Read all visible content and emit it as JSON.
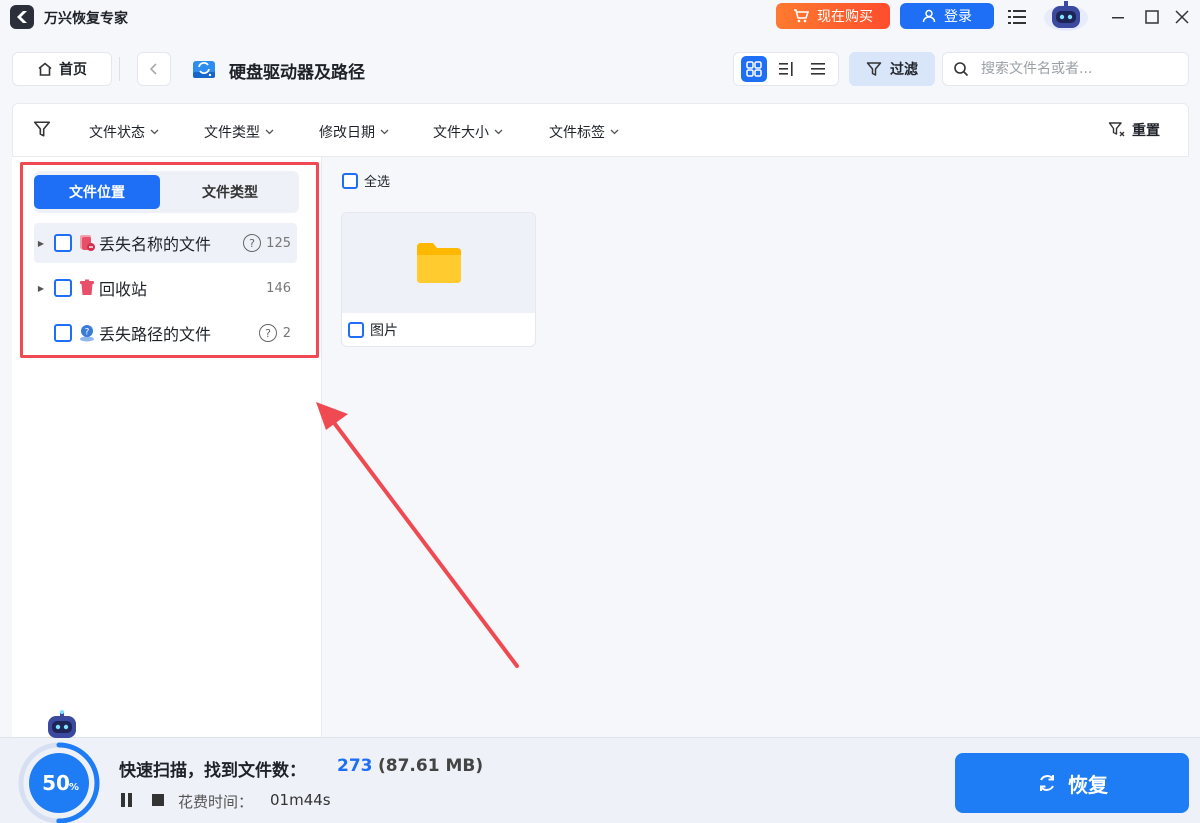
{
  "app": {
    "title": "万兴恢复专家",
    "buy_label": "现在购买",
    "login_label": "登录"
  },
  "toolbar": {
    "home_label": "首页",
    "path_title": "硬盘驱动器及路径",
    "filter_label": "过滤",
    "search_placeholder": "搜索文件名或者..."
  },
  "filter_bar": {
    "items": [
      "文件状态",
      "文件类型",
      "修改日期",
      "文件大小",
      "文件标签"
    ],
    "reset_label": "重置"
  },
  "left_panel": {
    "tabs": [
      {
        "label": "文件位置",
        "active": true
      },
      {
        "label": "文件类型",
        "active": false
      }
    ],
    "tree": [
      {
        "label": "丢失名称的文件",
        "count": "125",
        "help": true,
        "expandable": true,
        "icon": "lost-name-file-icon",
        "icon_color": "#e8506a"
      },
      {
        "label": "回收站",
        "count": "146",
        "help": false,
        "expandable": true,
        "icon": "recycle-bin-icon",
        "icon_color": "#e8506a"
      },
      {
        "label": "丢失路径的文件",
        "count": "2",
        "help": true,
        "expandable": false,
        "icon": "lost-path-file-icon",
        "icon_color": "#3a7bd5"
      }
    ]
  },
  "main": {
    "select_all_label": "全选",
    "folders": [
      {
        "label": "图片",
        "icon": "folder-icon",
        "icon_color": "#ffb800"
      }
    ]
  },
  "status": {
    "progress_percent": 50,
    "progress_text": "50",
    "percent_sign": "%",
    "scan_title": "快速扫描，找到文件数：",
    "found_count": "273",
    "found_size": "(87.61 MB)",
    "time_label": "花费时间：",
    "time_value": "01m44s",
    "recover_label": "恢复"
  },
  "colors": {
    "accent": "#1e6ff5",
    "buy_orange": "#ff5a2d",
    "highlight_red": "#ef4a52"
  }
}
